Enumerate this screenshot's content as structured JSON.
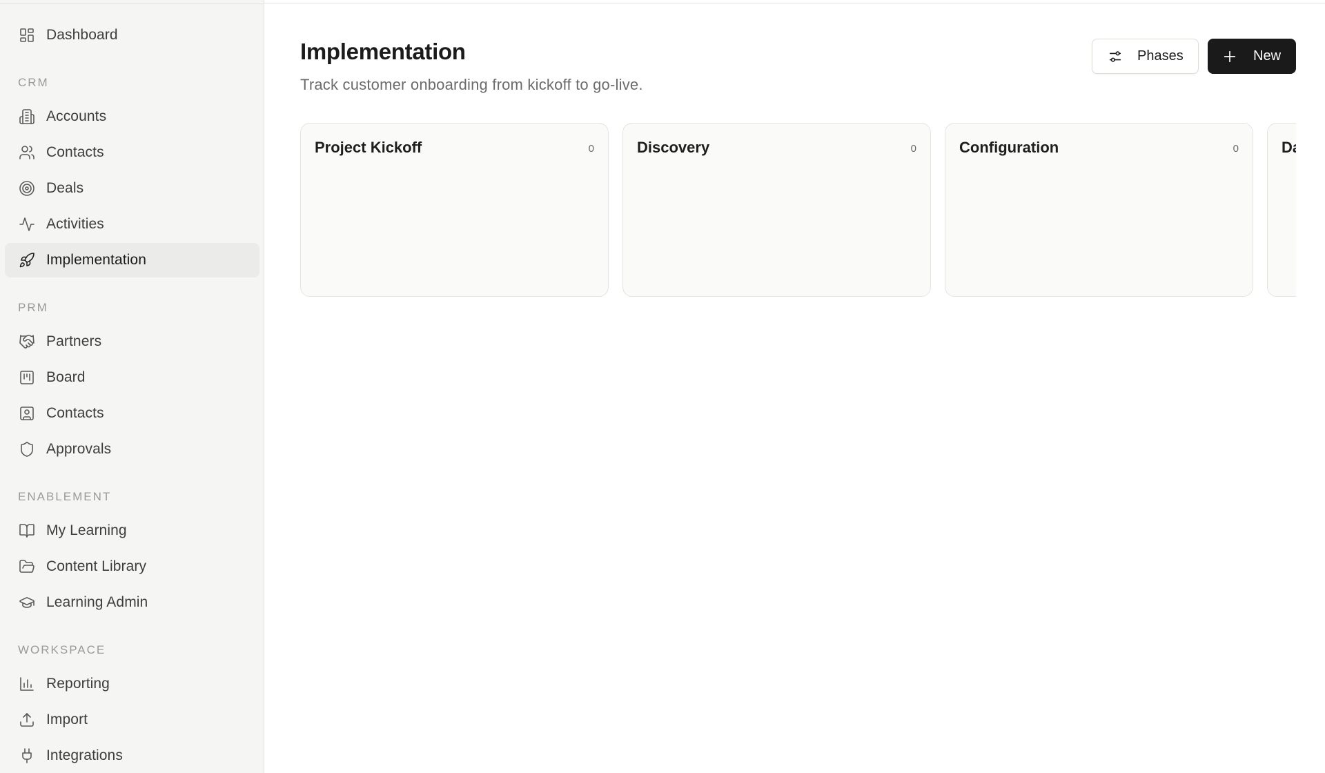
{
  "sidebar": {
    "items": {
      "dashboard": {
        "label": "Dashboard",
        "icon": "dashboard-icon"
      },
      "accounts": {
        "label": "Accounts",
        "icon": "building-icon"
      },
      "crm_contacts": {
        "label": "Contacts",
        "icon": "users-icon"
      },
      "deals": {
        "label": "Deals",
        "icon": "target-icon"
      },
      "activities": {
        "label": "Activities",
        "icon": "activity-icon"
      },
      "implementation": {
        "label": "Implementation",
        "icon": "rocket-icon",
        "active": true
      },
      "partners": {
        "label": "Partners",
        "icon": "handshake-icon"
      },
      "board": {
        "label": "Board",
        "icon": "kanban-icon"
      },
      "prm_contacts": {
        "label": "Contacts",
        "icon": "contact-card-icon"
      },
      "approvals": {
        "label": "Approvals",
        "icon": "shield-icon"
      },
      "my_learning": {
        "label": "My Learning",
        "icon": "book-icon"
      },
      "content_library": {
        "label": "Content Library",
        "icon": "folder-icon"
      },
      "learning_admin": {
        "label": "Learning Admin",
        "icon": "graduation-cap-icon"
      },
      "reporting": {
        "label": "Reporting",
        "icon": "bar-chart-icon"
      },
      "import": {
        "label": "Import",
        "icon": "upload-icon"
      },
      "integrations": {
        "label": "Integrations",
        "icon": "plug-icon"
      }
    },
    "sections": {
      "crm": "CRM",
      "prm": "PRM",
      "enablement": "ENABLEMENT",
      "workspace": "WORKSPACE"
    }
  },
  "header": {
    "title": "Implementation",
    "subtitle": "Track customer onboarding from kickoff to go-live.",
    "phases_label": "Phases",
    "new_label": "New"
  },
  "board": {
    "columns": [
      {
        "title": "Project Kickoff",
        "count": "0"
      },
      {
        "title": "Discovery",
        "count": "0"
      },
      {
        "title": "Configuration",
        "count": "0"
      },
      {
        "title": "Da",
        "count": ""
      }
    ]
  },
  "colors": {
    "sidebar_bg": "#f5f5f4",
    "active_item_bg": "#ebebea",
    "primary_button": "#1a1a1a",
    "column_bg": "#fafaf9"
  }
}
